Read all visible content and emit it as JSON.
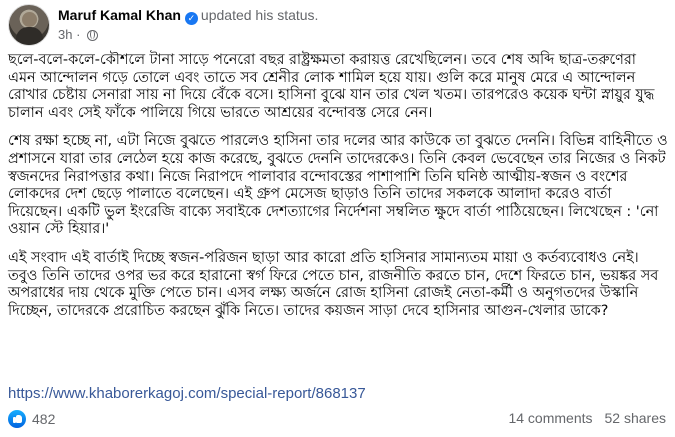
{
  "post": {
    "author": "Maruf Kamal Khan",
    "action": "updated his status.",
    "time": "3h",
    "verified_icon": "verified-check-icon",
    "audience_icon": "globe-icon",
    "paragraphs": [
      "ছলে-বলে-কলে-কৌশলে টানা সাড়ে পনেরো বছর রাষ্ট্রক্ষমতা করায়ত্ত রেখেছিলেন। তবে শেষ অব্দি ছাত্র-তরুণেরা এমন আন্দোলন গড়ে তোলে এবং তাতে সব শ্রেনীর লোক শামিল হয়ে যায়। গুলি করে মানুষ মেরে এ আন্দোলন রোখার চেষ্টায় সেনারা সায় না দিয়ে বেঁকে বসে। হাসিনা বুঝে যান তার খেল খতম। তারপরেও কয়েক ঘন্টা স্নায়ুর যুদ্ধ চালান এবং সেই ফাঁকে পালিয়ে গিয়ে ভারতে আশ্রয়ের বন্দোবস্ত সেরে নেন।",
      "শেষ রক্ষা হচ্ছে না, এটা নিজে বুঝতে পারলেও হাসিনা তার দলের আর কাউকে তা বুঝতে দেননি। বিভিন্ন বাহিনীতে ও প্রশাসনে যারা তার লেঠেল হয়ে কাজ করেছে, বুঝতে দেননি তাদেরকেও। তিনি কেবল ভেবেছেন তার নিজের ও নিকট স্বজনদের নিরাপত্তার কথা। নিজে নিরাপদে পালাবার বন্দোবস্তের পাশাপাশি তিনি ঘনিষ্ঠ আত্মীয়-স্বজন ও বংশের লোকদের দেশ ছেড়ে পালাতে বলেছেন। এই গ্রুপ মেসেজ ছাড়াও তিনি তাদের সকলকে আলাদা করেও বার্তা দিয়েছেন। একটি ভুল ইংরেজি বাক্যে সবাইকে দেশত্যাগের নির্দেশনা সম্বলিত ক্ষুদে বার্তা পাঠিয়েছেন। লিখেছেন : 'নো ওয়ান স্টে হিয়ার।'",
      "এই সংবাদ এই বার্তাই দিচ্ছে স্বজন-পরিজন ছাড়া আর কারো প্রতি হাসিনার সামান্যতম মায়া ও কর্তব্যবোধও নেই। তবুও তিনি তাদের ওপর ভর করে হারানো স্বর্গ ফিরে পেতে চান, রাজনীতি করতে চান, দেশে ফিরতে চান, ভয়ঙ্কর সব অপরাধের দায় থেকে মুক্তি পেতে চান। এসব লক্ষ্য অর্জনে রোজ হাসিনা রোজই নেতা-কর্মী ও অনুগতদের উস্কানি দিচ্ছেন, তাদেরকে প্ররোচিত করছেন ঝুঁকি নিতে। তাদের কয়জন সাড়া দেবে হাসিনার আগুন-খেলার ডাকে?"
    ],
    "link": "https://www.khaborerkagoj.com/special-report/868137"
  },
  "footer": {
    "reaction_icon": "like-icon",
    "reactions_count": "482",
    "comments": "14 comments",
    "shares": "52 shares"
  }
}
